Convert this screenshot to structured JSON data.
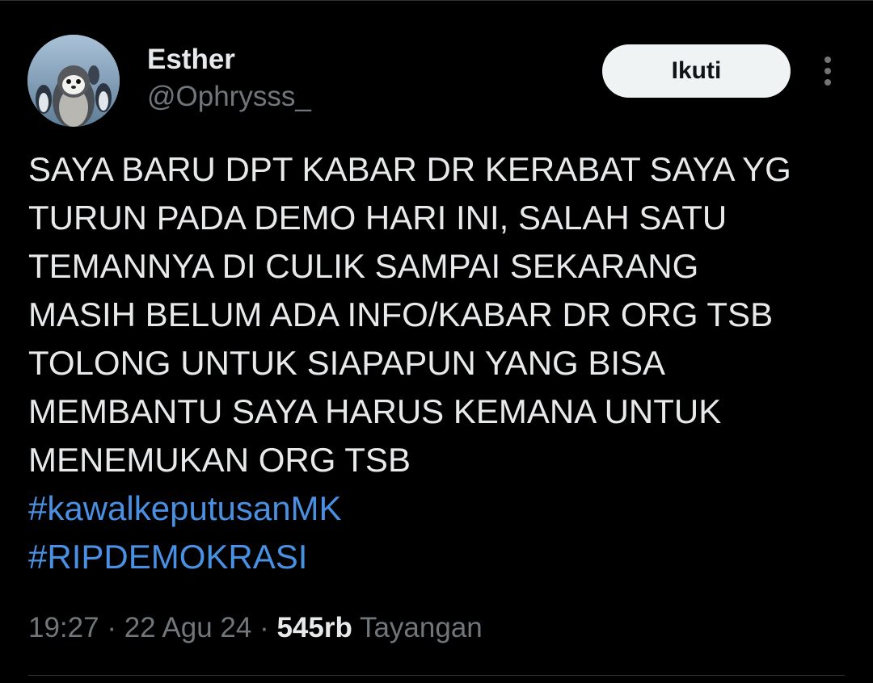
{
  "author": {
    "name": "Esther",
    "handle": "@Ophrysss_",
    "avatar_icon": "penguin-avatar"
  },
  "actions": {
    "follow_label": "Ikuti",
    "more_icon": "more-vertical-icon"
  },
  "tweet": {
    "lines": [
      "SAYA BARU DPT KABAR DR KERABAT SAYA YG",
      "TURUN PADA DEMO HARI INI, SALAH SATU",
      "TEMANNYA DI CULIK SAMPAI SEKARANG",
      "MASIH BELUM ADA INFO/KABAR DR ORG TSB",
      "TOLONG UNTUK SIAPAPUN YANG BISA",
      "MEMBANTU SAYA HARUS KEMANA UNTUK",
      "MENEMUKAN ORG TSB"
    ],
    "hashtags": [
      "#kawalkeputusanMK",
      "#RIPDEMOKRASI"
    ]
  },
  "meta": {
    "time": "19:27",
    "separator": " · ",
    "date": "22 Agu 24",
    "views_count": "545rb",
    "views_label": "Tayangan"
  },
  "colors": {
    "background": "#000000",
    "text": "#e7e9ea",
    "secondary": "#71767b",
    "link": "#4a90e2",
    "divider": "#2f3336"
  }
}
